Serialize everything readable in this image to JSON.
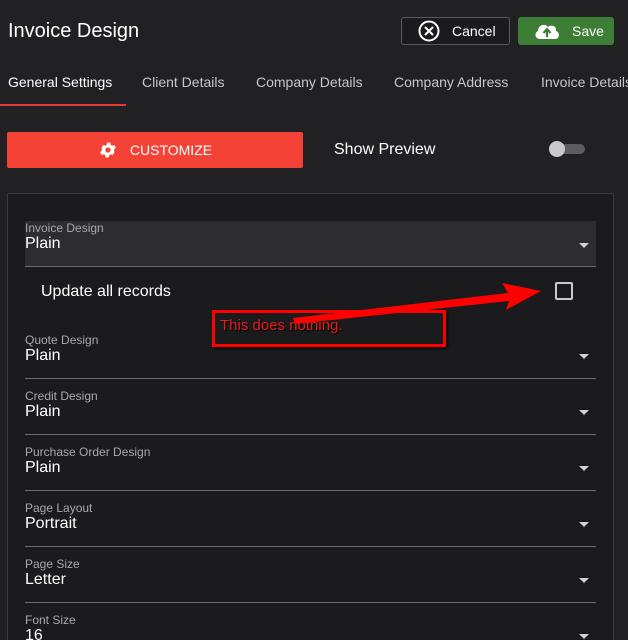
{
  "header": {
    "title": "Invoice Design",
    "cancel_label": "Cancel",
    "save_label": "Save"
  },
  "tabs": [
    {
      "label": "General Settings",
      "active": true
    },
    {
      "label": "Client Details",
      "active": false
    },
    {
      "label": "Company Details",
      "active": false
    },
    {
      "label": "Company Address",
      "active": false
    },
    {
      "label": "Invoice Details",
      "active": false
    }
  ],
  "toolbar": {
    "customize_label": "CUSTOMIZE",
    "show_preview_label": "Show Preview",
    "show_preview_on": false
  },
  "form": {
    "invoice_design": {
      "label": "Invoice Design",
      "value": "Plain"
    },
    "update_all_records": {
      "label": "Update all records",
      "checked": false
    },
    "quote_design": {
      "label": "Quote Design",
      "value": "Plain"
    },
    "credit_design": {
      "label": "Credit Design",
      "value": "Plain"
    },
    "purchase_order_design": {
      "label": "Purchase Order Design",
      "value": "Plain"
    },
    "page_layout": {
      "label": "Page Layout",
      "value": "Portrait"
    },
    "page_size": {
      "label": "Page Size",
      "value": "Letter"
    },
    "font_size": {
      "label": "Font Size",
      "value": "16"
    }
  },
  "annotation": {
    "text": "This does nothing.",
    "color": "#ff0000"
  },
  "colors": {
    "background": "#212124",
    "accent_red": "#f44336",
    "save_green": "#3d7e37"
  },
  "icons": {
    "cancel": "close-circle-icon",
    "save": "cloud-upload-icon",
    "customize": "gear-icon",
    "dropdown": "caret-down-icon"
  }
}
